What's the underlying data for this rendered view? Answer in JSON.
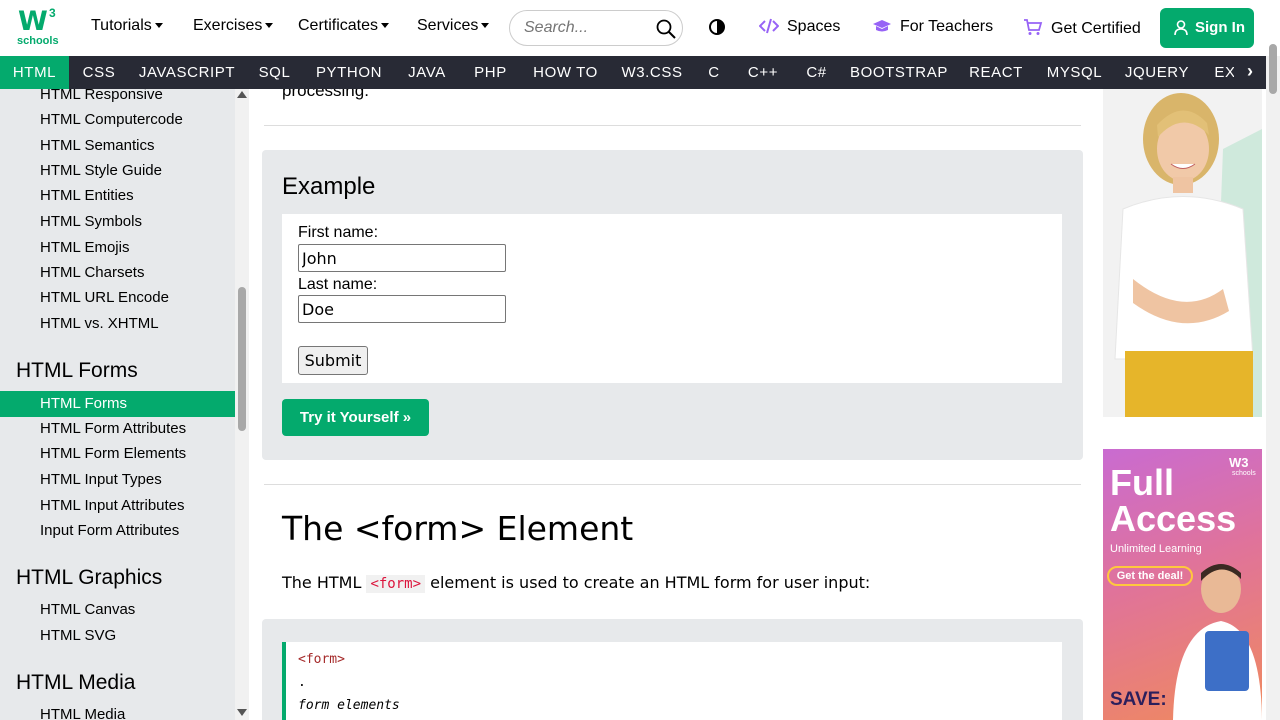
{
  "logo": {
    "mark": "W",
    "sup": "3",
    "word": "schools"
  },
  "header": {
    "menus": [
      "Tutorials",
      "Exercises",
      "Certificates",
      "Services"
    ],
    "search_placeholder": "Search...",
    "spaces": "Spaces",
    "teachers": "For Teachers",
    "certified": "Get Certified",
    "signin": "Sign In"
  },
  "subjects": [
    "HTML",
    "CSS",
    "JAVASCRIPT",
    "SQL",
    "PYTHON",
    "JAVA",
    "PHP",
    "HOW TO",
    "W3.CSS",
    "C",
    "C++",
    "C#",
    "BOOTSTRAP",
    "REACT",
    "MYSQL",
    "JQUERY",
    "EX"
  ],
  "sidebar": {
    "group1": [
      "HTML Responsive",
      "HTML Computercode",
      "HTML Semantics",
      "HTML Style Guide",
      "HTML Entities",
      "HTML Symbols",
      "HTML Emojis",
      "HTML Charsets",
      "HTML URL Encode",
      "HTML vs. XHTML"
    ],
    "head_forms": "HTML Forms",
    "forms": [
      "HTML Forms",
      "HTML Form Attributes",
      "HTML Form Elements",
      "HTML Input Types",
      "HTML Input Attributes",
      "Input Form Attributes"
    ],
    "head_graphics": "HTML Graphics",
    "graphics": [
      "HTML Canvas",
      "HTML SVG"
    ],
    "head_media": "HTML Media",
    "media": [
      "HTML Media"
    ]
  },
  "main": {
    "prev_text": "processing.",
    "example_title": "Example",
    "first_label": "First name:",
    "first_value": "John",
    "last_label": "Last name:",
    "last_value": "Doe",
    "submit": "Submit",
    "tryit": "Try it Yourself »",
    "heading": "The <form> Element",
    "para_before": "The HTML ",
    "para_code": "<form>",
    "para_after": " element is used to create an HTML form for user input:",
    "code": {
      "open": "<form>",
      "dot": ".",
      "elements": "form elements"
    }
  },
  "ads": {
    "full": "Full",
    "access": "Access",
    "unlimited": "Unlimited Learning",
    "deal": "Get the deal!",
    "save": "SAVE:",
    "logo": "W3",
    "logo_word": "schools"
  },
  "colors": {
    "accent": "#04AA6D",
    "dark": "#282A35",
    "sidebar": "#E7E9EB",
    "purple": "#9763f6"
  }
}
